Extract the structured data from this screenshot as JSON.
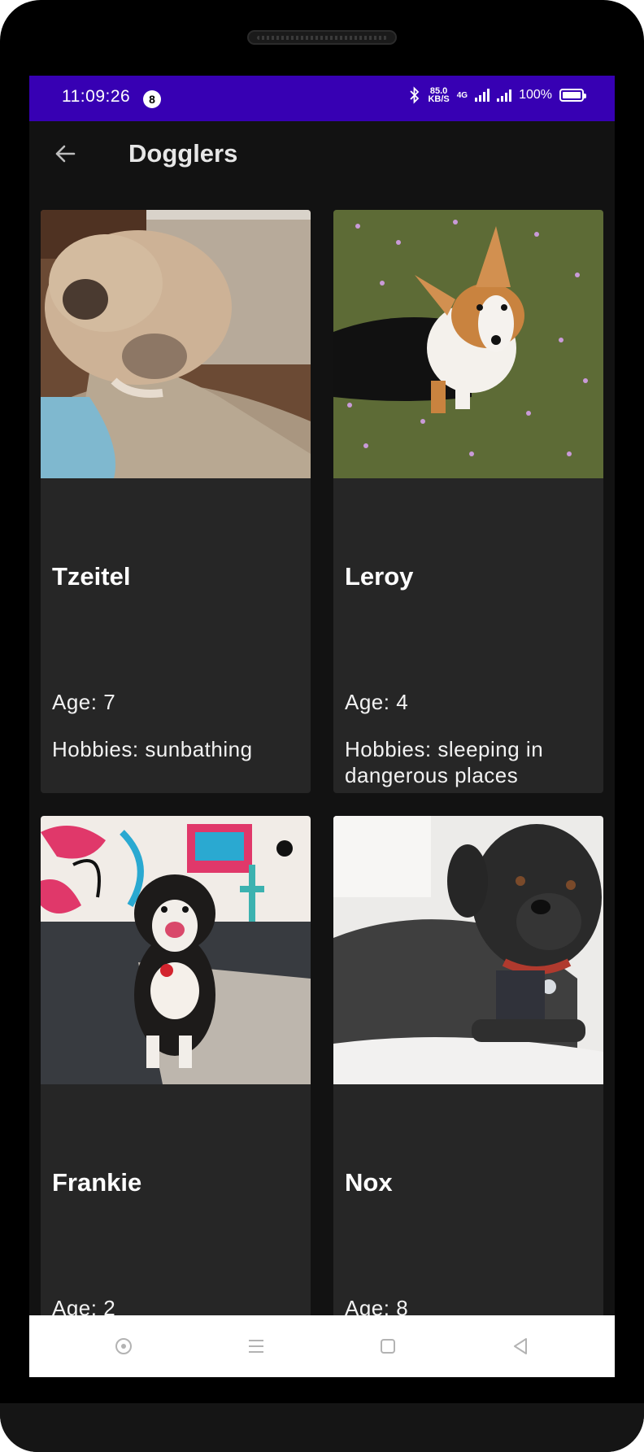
{
  "status_bar": {
    "time": "11:09:26",
    "notification_count": "8",
    "net_speed_value": "85.0",
    "net_speed_unit": "KB/S",
    "network_type": "4G",
    "battery": "100%"
  },
  "app_bar": {
    "title": "Dogglers",
    "back_icon": "arrow-left-icon"
  },
  "dogs": [
    {
      "name": "Tzeitel",
      "age": "Age: 7",
      "hobbies": "Hobbies: sunbathing"
    },
    {
      "name": "Leroy",
      "age": "Age: 4",
      "hobbies": "Hobbies: sleeping in dangerous places"
    },
    {
      "name": "Frankie",
      "age": "Age: 2",
      "hobbies": ""
    },
    {
      "name": "Nox",
      "age": "Age: 8",
      "hobbies": ""
    }
  ],
  "nav_bar": {
    "icons": [
      "circle-dot-icon",
      "menu-icon",
      "square-icon",
      "triangle-back-icon"
    ]
  },
  "colors": {
    "status_bar": "#3700b3",
    "background": "#121212",
    "card": "#262626"
  }
}
